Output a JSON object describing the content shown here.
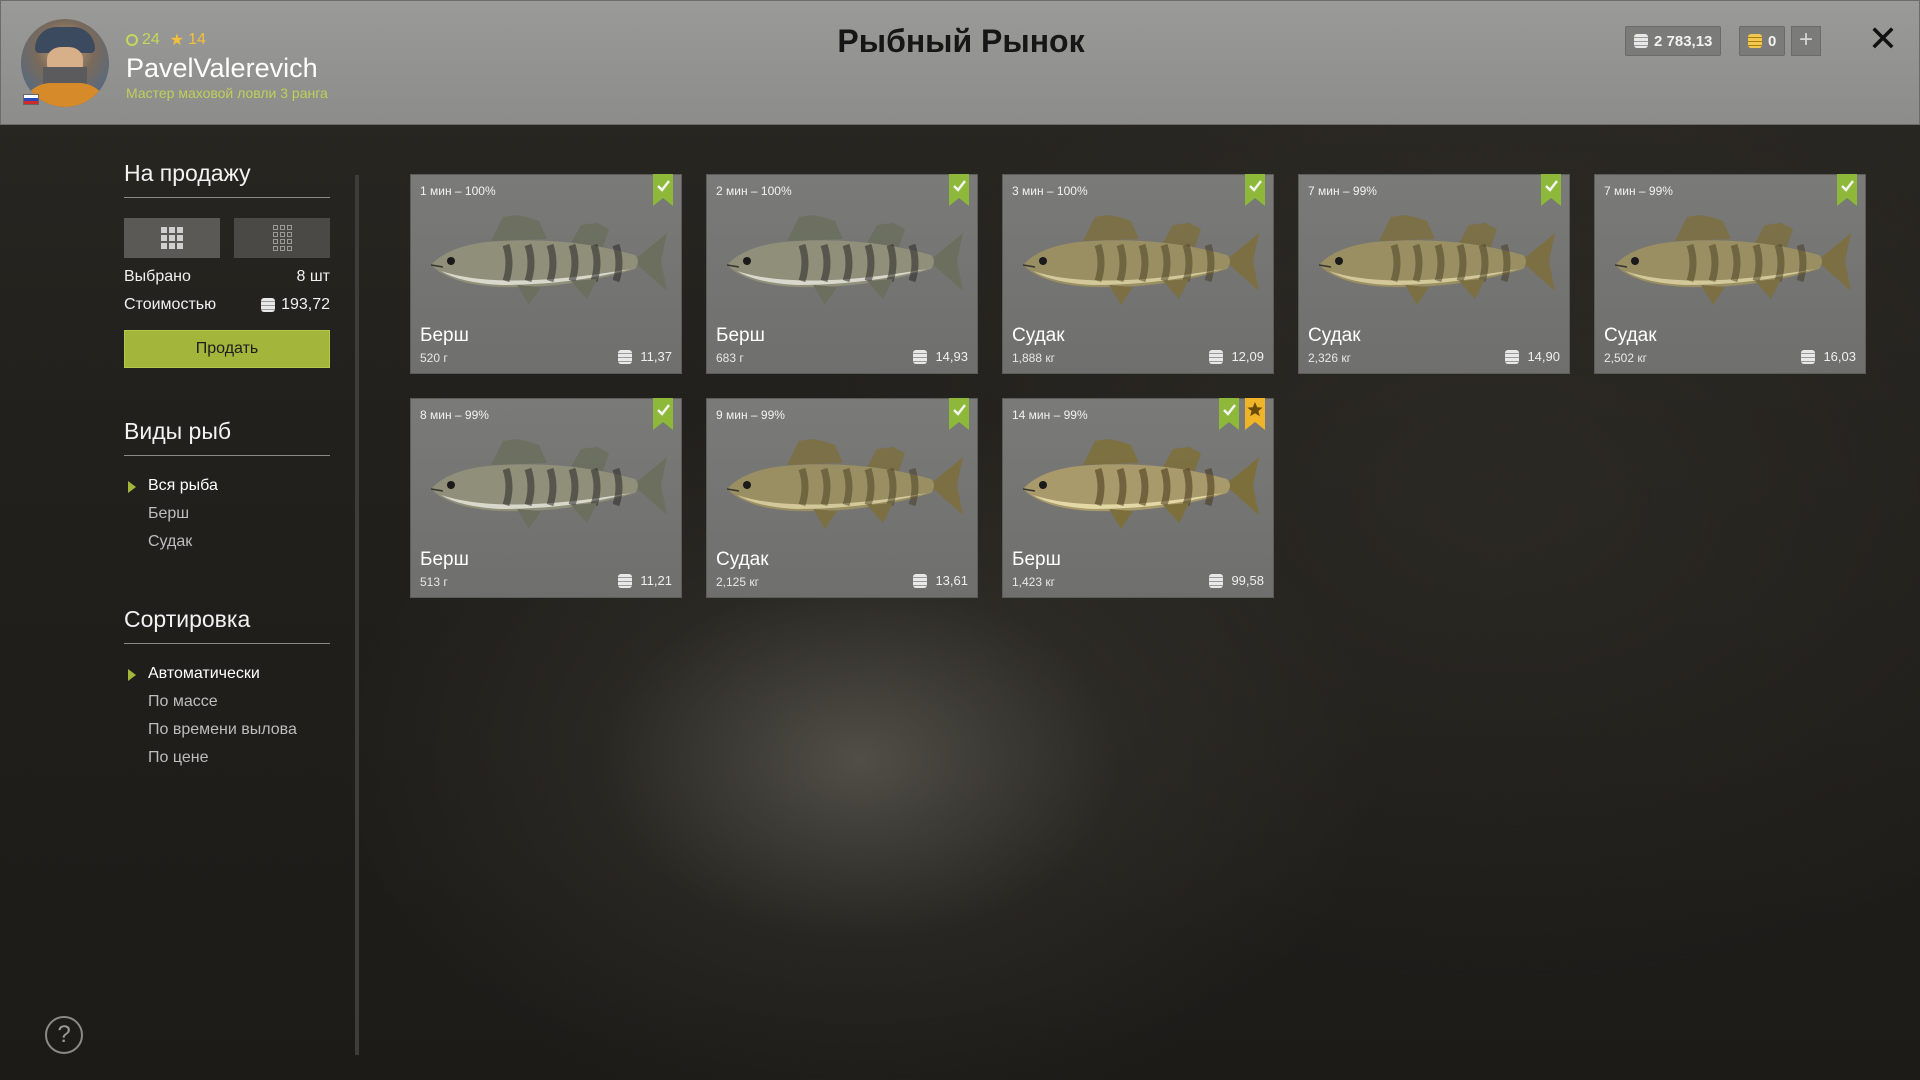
{
  "header": {
    "title": "Рыбный Рынок",
    "level": "24",
    "stars": "14",
    "username": "PavelValerevich",
    "rank": "Мастер маховой ловли 3 ранга",
    "silver": "2 783,13",
    "gold": "0",
    "plus_label": "+",
    "close_label": "✕"
  },
  "sidebar": {
    "for_sale_title": "На продажу",
    "selected_label": "Выбрано",
    "selected_value": "8 шт",
    "cost_label": "Стоимостью",
    "cost_value": "193,72",
    "sell_button": "Продать",
    "species_title": "Виды рыб",
    "species": [
      {
        "label": "Вся рыба",
        "active": true
      },
      {
        "label": "Берш",
        "active": false
      },
      {
        "label": "Судак",
        "active": false
      }
    ],
    "sort_title": "Сортировка",
    "sort": [
      {
        "label": "Автоматически",
        "active": true
      },
      {
        "label": "По массе",
        "active": false
      },
      {
        "label": "По времени вылова",
        "active": false
      },
      {
        "label": "По цене",
        "active": false
      }
    ]
  },
  "cards": [
    {
      "time": "1 мин – 100%",
      "name": "Берш",
      "weight": "520 г",
      "price": "11,37",
      "fish": "bersh",
      "starred": false
    },
    {
      "time": "2 мин – 100%",
      "name": "Берш",
      "weight": "683 г",
      "price": "14,93",
      "fish": "bersh",
      "starred": false
    },
    {
      "time": "3 мин – 100%",
      "name": "Судак",
      "weight": "1,888 кг",
      "price": "12,09",
      "fish": "sudak",
      "starred": false
    },
    {
      "time": "7 мин – 99%",
      "name": "Судак",
      "weight": "2,326 кг",
      "price": "14,90",
      "fish": "sudak",
      "starred": false
    },
    {
      "time": "7 мин – 99%",
      "name": "Судак",
      "weight": "2,502 кг",
      "price": "16,03",
      "fish": "sudak",
      "starred": false
    },
    {
      "time": "8 мин – 99%",
      "name": "Берш",
      "weight": "513 г",
      "price": "11,21",
      "fish": "bersh",
      "starred": false
    },
    {
      "time": "9 мин – 99%",
      "name": "Судак",
      "weight": "2,125 кг",
      "price": "13,61",
      "fish": "sudak",
      "starred": false
    },
    {
      "time": "14 мин – 99%",
      "name": "Берш",
      "weight": "1,423 кг",
      "price": "99,58",
      "fish": "bersh-trophy",
      "starred": true
    }
  ],
  "colors": {
    "accent": "#a3b53a",
    "check_badge": "#8db83a",
    "star_badge": "#f0b429"
  },
  "icons": {
    "help": "?"
  }
}
